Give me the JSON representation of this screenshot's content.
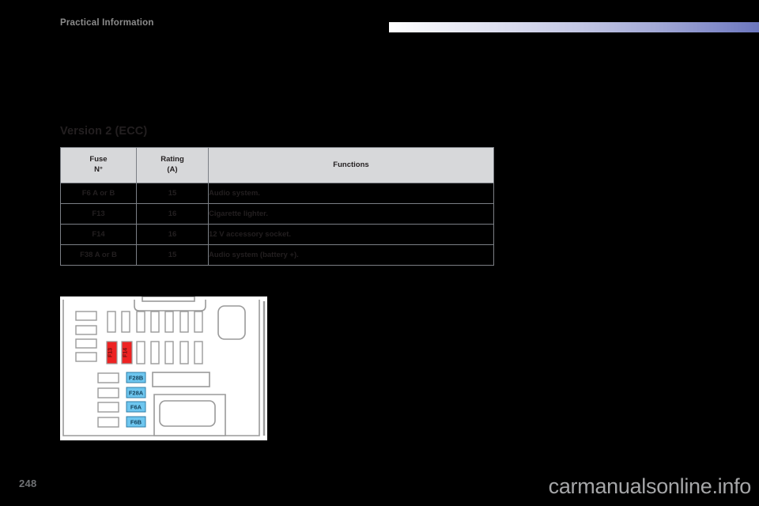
{
  "header": {
    "title": "Practical Information",
    "gradient_from": "#ffffff",
    "gradient_to": "#6b76bd"
  },
  "section": {
    "title": "Version 2 (ECC)"
  },
  "table": {
    "columns": [
      {
        "line1": "Fuse",
        "line2": "N°"
      },
      {
        "line1": "Rating",
        "line2": "(A)"
      },
      {
        "line1": "Functions",
        "line2": ""
      }
    ],
    "header_bg": "#d7d8da",
    "border_color": "#7b7f85",
    "rows": [
      {
        "fuse": "F6 A or B",
        "rating": "15",
        "functions": "Audio system."
      },
      {
        "fuse": "F13",
        "rating": "16",
        "functions": "Cigarette lighter."
      },
      {
        "fuse": "F14",
        "rating": "16",
        "functions": "12 V accessory socket."
      },
      {
        "fuse": "F38 A or B",
        "rating": "15",
        "functions": "Audio system (battery +)."
      }
    ]
  },
  "diagram": {
    "name": "fuse-box-diagram",
    "highlight_color_red": "#ee2222",
    "highlight_color_blue": "#6ec6ef",
    "outline_color": "#9a9a9a",
    "red_fuses": [
      {
        "label": "F13"
      },
      {
        "label": "F14"
      }
    ],
    "blue_labels": [
      {
        "label": "F28B"
      },
      {
        "label": "F28A"
      },
      {
        "label": "F6A"
      },
      {
        "label": "F6B"
      }
    ]
  },
  "footer": {
    "page_number": "248",
    "watermark": "carmanualsonline.info"
  }
}
